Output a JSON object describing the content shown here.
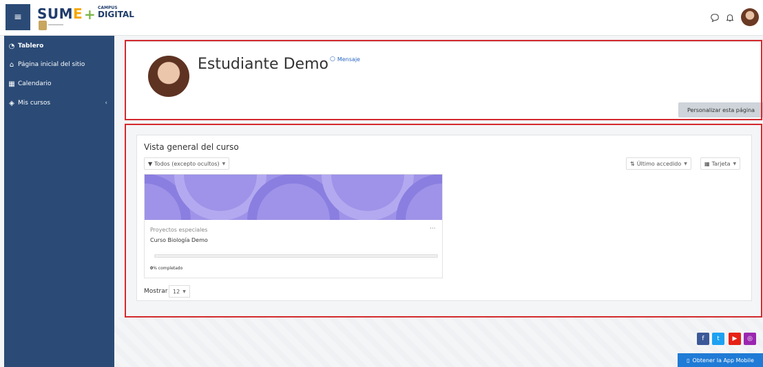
{
  "navbar": {
    "menu_icon": "hamburger-icon",
    "logo": {
      "sume": "SUM",
      "e": "E",
      "plus": "+",
      "campus": "CAMPUS",
      "digital": "DIGITAL"
    },
    "icons": [
      "message-icon",
      "bell-icon"
    ]
  },
  "sidebar": {
    "items": [
      {
        "label": "Tablero",
        "icon": "dashboard-icon"
      },
      {
        "label": "Página inicial del sitio",
        "icon": "home-icon"
      },
      {
        "label": "Calendario",
        "icon": "calendar-icon"
      },
      {
        "label": "Mis cursos",
        "icon": "graduation-cap-icon"
      }
    ]
  },
  "profile": {
    "name": "Estudiante Demo",
    "message_label": "Mensaje",
    "customize_button": "Personalizar esta página"
  },
  "course_overview": {
    "title": "Vista general del curso",
    "filter_label": "Todos (excepto ocultos)",
    "sort_label": "Último accedido",
    "view_label": "Tarjeta",
    "courses": [
      {
        "category": "Proyectos especiales",
        "name": "Curso Biología Demo",
        "progress_percent": "0",
        "progress_suffix": "% completado"
      }
    ],
    "show_label": "Mostrar",
    "show_value": "12"
  },
  "footer": {
    "social": [
      {
        "icon": "facebook-icon",
        "color": "#3b5998"
      },
      {
        "icon": "twitter-icon",
        "color": "#1da1f2"
      },
      {
        "icon": "youtube-icon",
        "color": "#e62117"
      },
      {
        "icon": "instagram-icon",
        "color": "#9b27b0"
      }
    ],
    "app_button": "Obtener la App Mobile"
  },
  "colors": {
    "sidebar": "#2b4b76",
    "highlight": "#d3292e",
    "link": "#2a66c2"
  }
}
